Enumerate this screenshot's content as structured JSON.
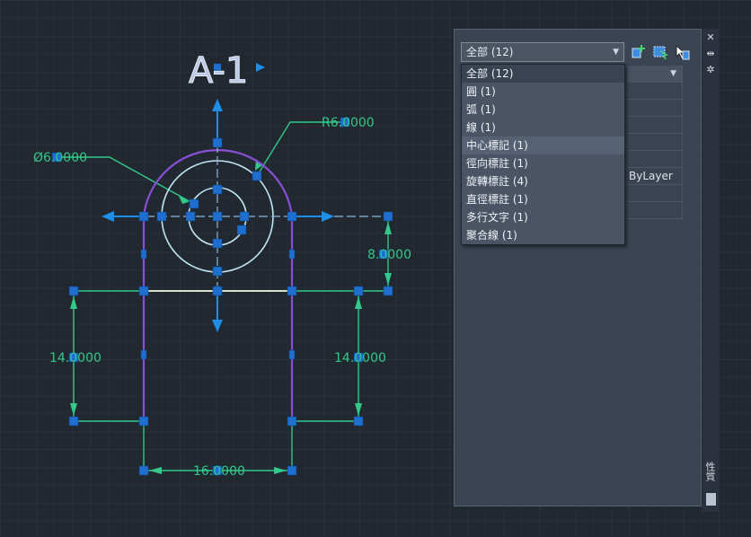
{
  "drawing": {
    "block_label": "A-1",
    "dims": {
      "diameter": "Ø6.0000",
      "radius": "R6.0000",
      "right_height": "8.0000",
      "left_height": "14.0000",
      "right_inner_height": "14.0000",
      "bottom_width": "16.0000"
    }
  },
  "properties_panel": {
    "selector_value": "全部 (12)",
    "dropdown_options": [
      "全部 (12)",
      "圓 (1)",
      "弧 (1)",
      "線 (1)",
      "中心標記 (1)",
      "徑向標註 (1)",
      "旋轉標註 (4)",
      "直徑標註 (1)",
      "多行文字 (1)",
      "聚合線 (1)"
    ],
    "highlighted_option": "中心標記 (1)",
    "grid_value_bylayer": "ByLayer",
    "side_label": "性質"
  },
  "colors": {
    "background": "#212830",
    "dimension": "#32c98a",
    "geometry": "#c0e6f5",
    "arc": "#8a4fd9",
    "grip": "#1e6fd0"
  }
}
